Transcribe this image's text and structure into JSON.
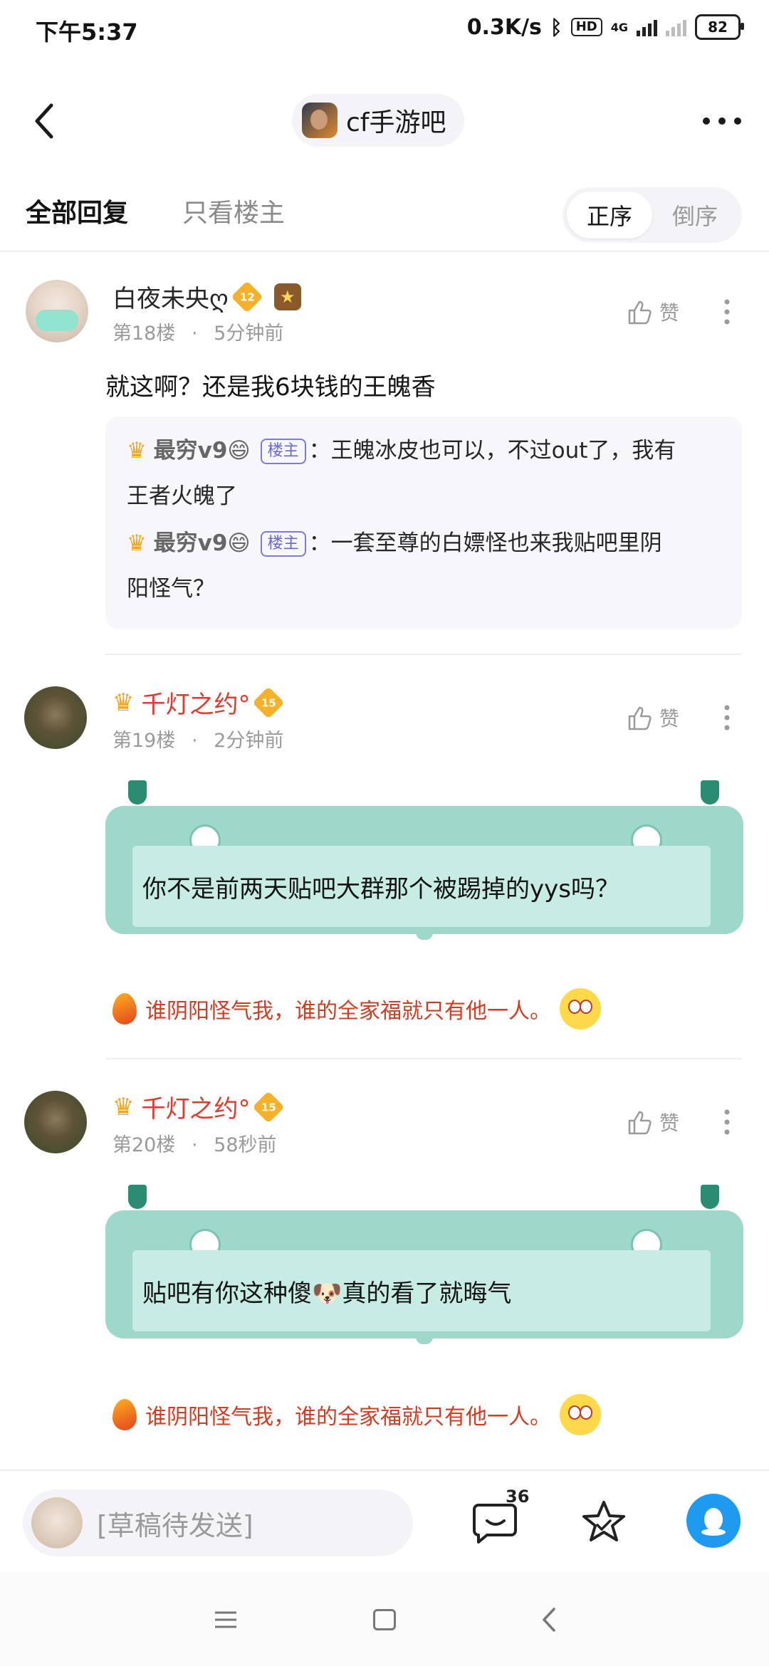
{
  "status": {
    "time": "下午5:37",
    "net_speed": "0.3K/s",
    "hd": "HD",
    "network": "4G",
    "battery": "82"
  },
  "header": {
    "forum_name": "cf手游吧"
  },
  "tabs": {
    "all": "全部回复",
    "owner_only": "只看楼主",
    "order_asc": "正序",
    "order_desc": "倒序"
  },
  "like_label": "赞",
  "posts": [
    {
      "username": "白夜未央ღ",
      "level": "12",
      "floor": "第18楼",
      "time": "5分钟前",
      "content": "就这啊？还是我6块钱的王魄香",
      "quotes": [
        {
          "name": "最穷v9😄",
          "tag": "楼主",
          "text_line1": "：王魄冰皮也可以，不过out了，我有",
          "text_line2": "王者火魄了"
        },
        {
          "name": "最穷v9😄",
          "tag": "楼主",
          "text_line1": "：一套至尊的白嫖怪也来我贴吧里阴",
          "text_line2": "阳怪气？"
        }
      ]
    },
    {
      "username": "千灯之约°",
      "level": "15",
      "floor": "第19楼",
      "time": "2分钟前",
      "content": "你不是前两天贴吧大群那个被踢掉的yys吗？",
      "tail": "谁阴阳怪气我，谁的全家福就只有他一人。"
    },
    {
      "username": "千灯之约°",
      "level": "15",
      "floor": "第20楼",
      "time": "58秒前",
      "content": "贴吧有你这种傻🐶真的看了就晦气",
      "tail": "谁阴阳怪气我，谁的全家福就只有他一人。"
    }
  ],
  "bottom": {
    "draft_placeholder": "[草稿待发送]",
    "comment_count": "36"
  }
}
